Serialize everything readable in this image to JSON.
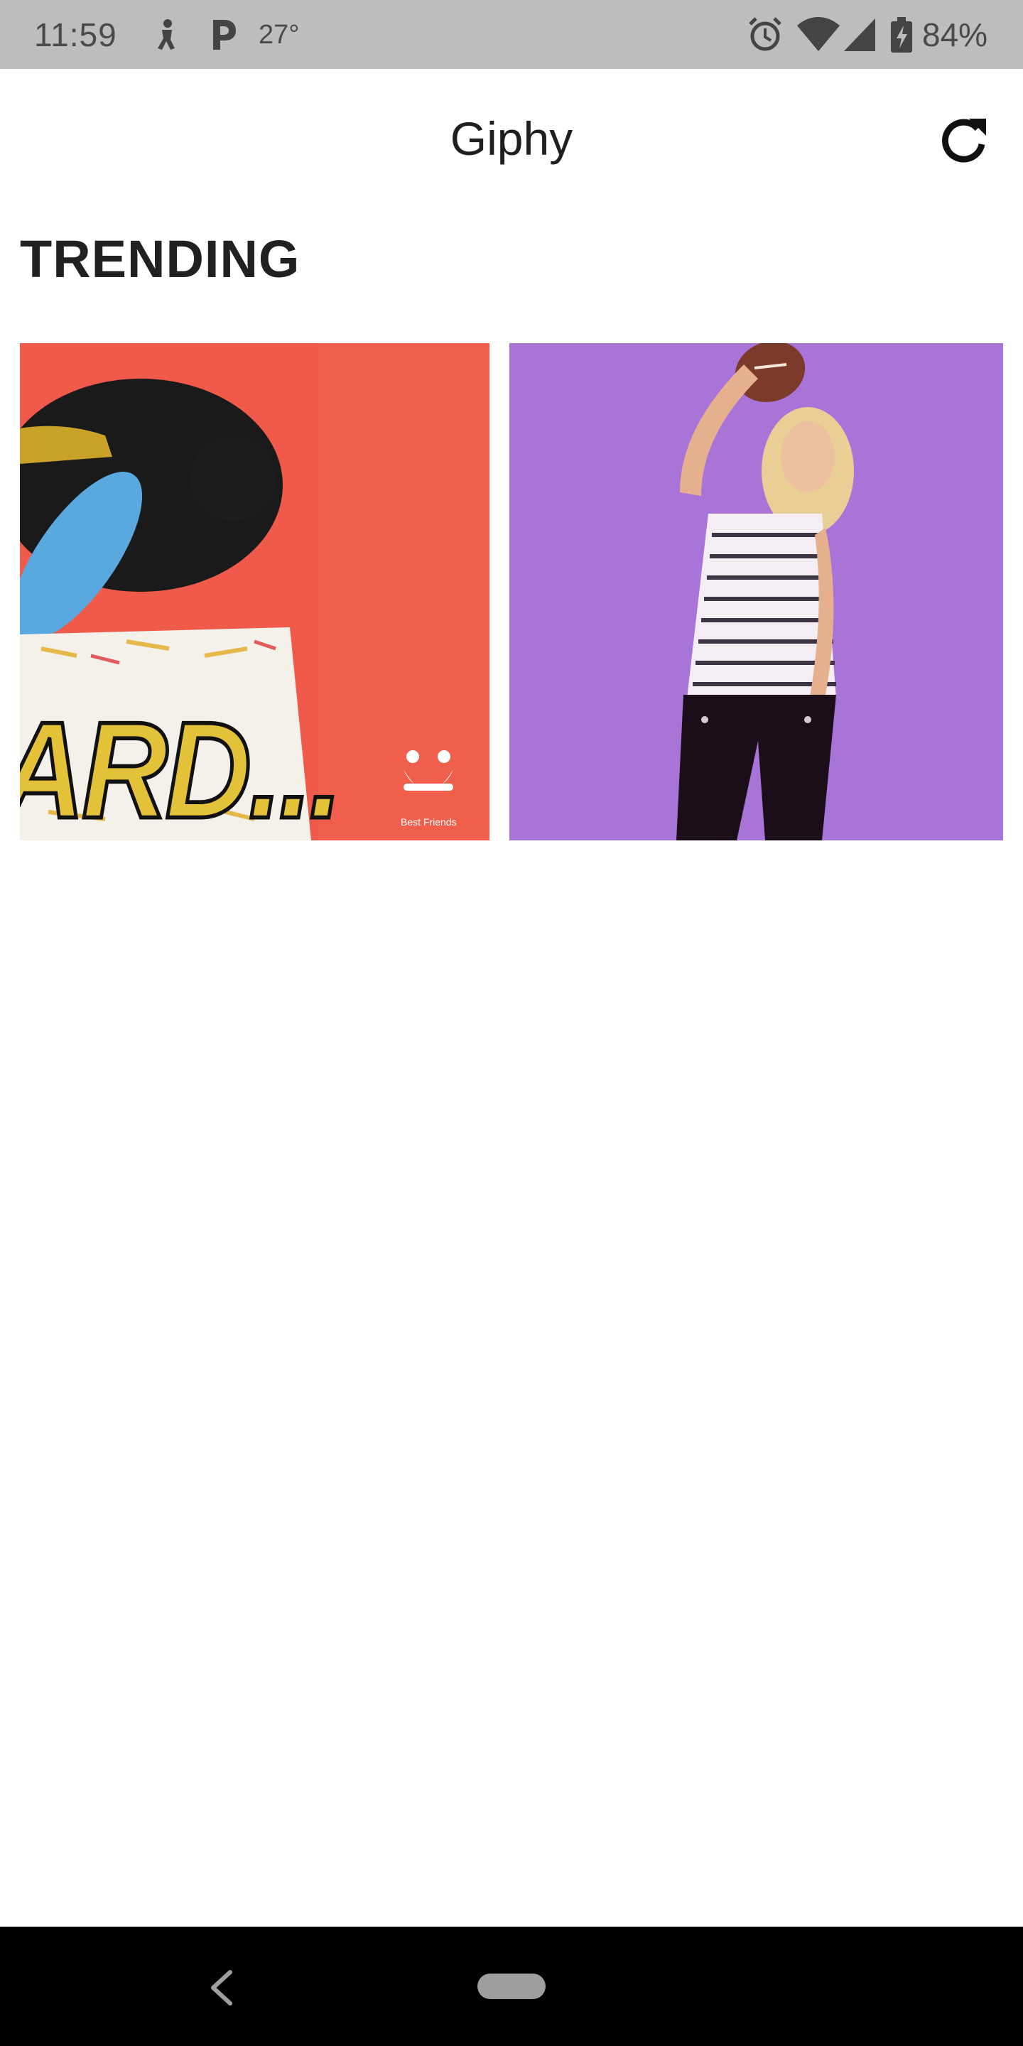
{
  "status_bar": {
    "time": "11:59",
    "temperature": "27°",
    "battery": "84%",
    "icons": [
      "run-notification-icon",
      "parking-notification-icon",
      "alarm-icon",
      "wifi-icon",
      "cell-signal-icon",
      "battery-charging-icon"
    ]
  },
  "app_bar": {
    "title": "Giphy",
    "refresh_icon": "refresh-icon"
  },
  "section": {
    "heading": "TRENDING"
  },
  "gifs": [
    {
      "name": "pug-gif",
      "background": "#ef5a4a",
      "caption_text": "ARD...",
      "watermark": "Best Friends"
    },
    {
      "name": "woman-football-gif",
      "background": "#a974d8"
    }
  ],
  "nav_bar": {
    "back_icon": "back-icon",
    "home_icon": "home-pill-icon"
  },
  "colors": {
    "status_bar_bg": "#bdbdbd",
    "nav_bar_bg": "#000000",
    "text_primary": "#212121"
  }
}
